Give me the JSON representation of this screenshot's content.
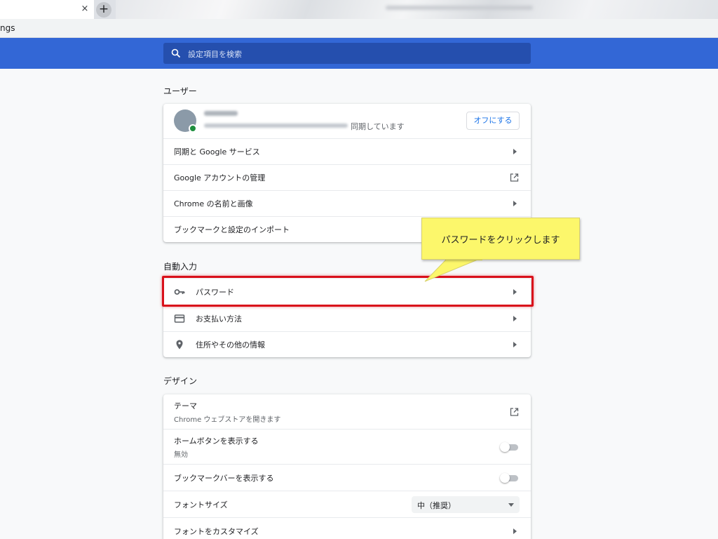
{
  "browser": {
    "tab_close": "×",
    "new_tab": "+",
    "url_fragment": "ngs"
  },
  "search": {
    "placeholder": "設定項目を検索"
  },
  "colors": {
    "header_blue": "#3367d6",
    "search_bg": "#254fae",
    "highlight_red": "#d9101a",
    "callout_yellow": "#fcf76b",
    "link_blue": "#1a73e8"
  },
  "user_section": {
    "title": "ユーザー",
    "profile_status": "同期しています",
    "off_button": "オフにする",
    "items": [
      {
        "label": "同期と Google サービス",
        "icon": "arrow-right-icon"
      },
      {
        "label": "Google アカウントの管理",
        "icon": "external-link-icon"
      },
      {
        "label": "Chrome の名前と画像",
        "icon": "arrow-right-icon"
      },
      {
        "label": "ブックマークと設定のインポート",
        "icon": "arrow-right-icon"
      }
    ]
  },
  "autofill_section": {
    "title": "自動入力",
    "items": [
      {
        "label": "パスワード",
        "icon": "key-icon"
      },
      {
        "label": "お支払い方法",
        "icon": "credit-card-icon"
      },
      {
        "label": "住所やその他の情報",
        "icon": "location-pin-icon"
      }
    ]
  },
  "design_section": {
    "title": "デザイン",
    "theme": {
      "label": "テーマ",
      "sub": "Chrome ウェブストアを開きます"
    },
    "home_button": {
      "label": "ホームボタンを表示する",
      "sub": "無効",
      "enabled": false
    },
    "bookmarks_bar": {
      "label": "ブックマークバーを表示する",
      "enabled": false
    },
    "font_size": {
      "label": "フォントサイズ",
      "value": "中（推奨）"
    },
    "customize_fonts": {
      "label": "フォントをカスタマイズ"
    }
  },
  "annotation": {
    "callout": "パスワードをクリックします"
  }
}
